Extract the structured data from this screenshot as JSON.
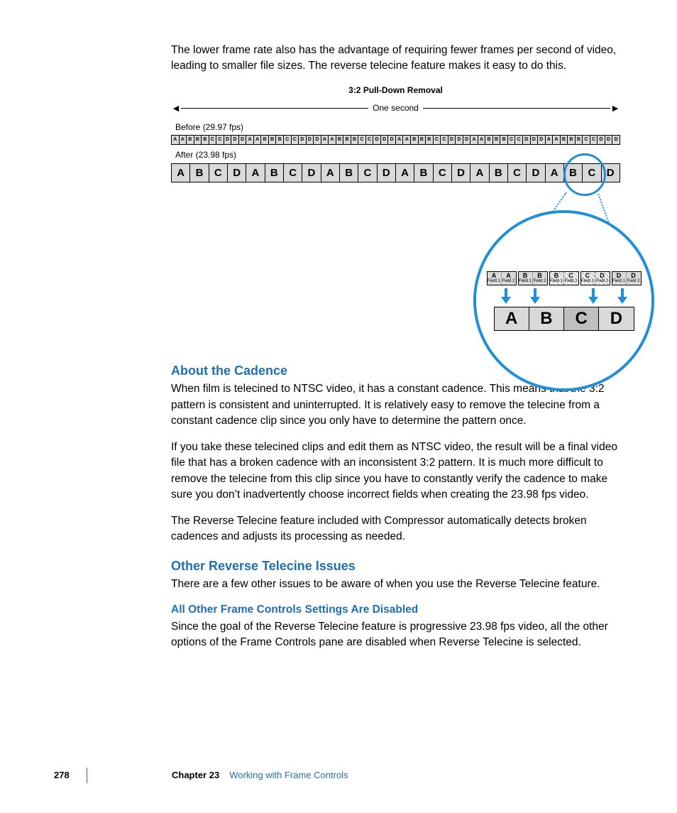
{
  "intro": "The lower frame rate also has the advantage of requiring fewer frames per second of video, leading to smaller file sizes. The reverse telecine feature makes it easy to do this.",
  "diagram": {
    "title": "3:2 Pull-Down Removal",
    "span_label": "One second",
    "before_label": "Before (29.97 fps)",
    "after_label": "After (23.98 fps)",
    "before_cells": [
      "A",
      "A",
      "B",
      "B",
      "B",
      "C",
      "C",
      "D",
      "D",
      "D",
      "A",
      "A",
      "B",
      "B",
      "B",
      "C",
      "C",
      "D",
      "D",
      "D",
      "A",
      "A",
      "B",
      "B",
      "B",
      "C",
      "C",
      "D",
      "D",
      "D",
      "A",
      "A",
      "B",
      "B",
      "B",
      "C",
      "C",
      "D",
      "D",
      "D",
      "A",
      "A",
      "B",
      "B",
      "B",
      "C",
      "C",
      "D",
      "D",
      "D",
      "A",
      "A",
      "B",
      "B",
      "B",
      "C",
      "C",
      "D",
      "D",
      "D"
    ],
    "after_cells": [
      "A",
      "B",
      "C",
      "D",
      "A",
      "B",
      "C",
      "D",
      "A",
      "B",
      "C",
      "D",
      "A",
      "B",
      "C",
      "D",
      "A",
      "B",
      "C",
      "D",
      "A",
      "B",
      "C",
      "D"
    ],
    "zoom_fields": [
      {
        "l": "A",
        "r": "A",
        "hatch": false
      },
      {
        "l": "B",
        "r": "B",
        "hatch": false
      },
      {
        "l": "B",
        "r": "C",
        "hatch": true
      },
      {
        "l": "C",
        "r": "D",
        "hatch": true
      },
      {
        "l": "D",
        "r": "D",
        "hatch": false
      }
    ],
    "field_sub_l": "Field 1",
    "field_sub_r": "Field 2",
    "result": [
      "A",
      "B",
      "C",
      "D"
    ]
  },
  "h_cadence": "About the Cadence",
  "p_cadence1": "When film is telecined to NTSC video, it has a constant cadence. This means that the 3:2 pattern is consistent and uninterrupted. It is relatively easy to remove the telecine from a constant cadence clip since you only have to determine the pattern once.",
  "p_cadence2": "If you take these telecined clips and edit them as NTSC video, the result will be a final video file that has a broken cadence with an inconsistent 3:2 pattern. It is much more difficult to remove the telecine from this clip since you have to constantly verify the cadence to make sure you don’t inadvertently choose incorrect fields when creating the 23.98 fps video.",
  "p_cadence3": "The Reverse Telecine feature included with Compressor automatically detects broken cadences and adjusts its processing as needed.",
  "h_other": "Other Reverse Telecine Issues",
  "p_other1": "There are a few other issues to be aware of when you use the Reverse Telecine feature.",
  "h_disabled": "All Other Frame Controls Settings Are Disabled",
  "p_disabled": "Since the goal of the Reverse Telecine feature is progressive 23.98 fps video, all the other options of the Frame Controls pane are disabled when Reverse Telecine is selected.",
  "footer": {
    "page": "278",
    "chapter_label": "Chapter 23",
    "chapter_name": "Working with Frame Controls"
  }
}
